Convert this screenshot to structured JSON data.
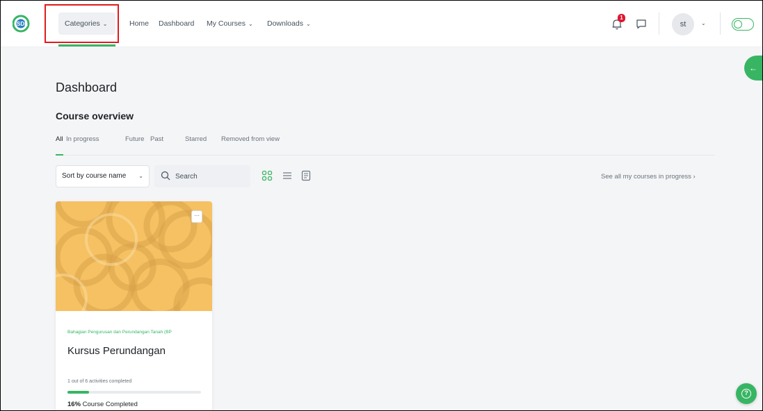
{
  "logo": {
    "text": "SDL"
  },
  "nav": {
    "items": [
      {
        "label": "Categories",
        "has_dropdown": true
      },
      {
        "label": "Home",
        "has_dropdown": false
      },
      {
        "label": "Dashboard",
        "has_dropdown": false
      },
      {
        "label": "My Courses",
        "has_dropdown": true
      },
      {
        "label": "Downloads",
        "has_dropdown": true
      }
    ],
    "notification_count": "1",
    "user_initials": "st"
  },
  "colors": {
    "accent": "#37b563",
    "highlight_box": "#e01a1a",
    "badge": "#e0142e"
  },
  "page": {
    "title": "Dashboard",
    "section_title": "Course overview",
    "tabs": [
      "All",
      "In progress",
      "Future",
      "Past",
      "Starred",
      "Removed from view"
    ],
    "active_tab": "All",
    "sort_label": "Sort by course name",
    "search_placeholder": "Search",
    "view_modes": [
      "grid-view-icon",
      "list-view-icon",
      "summary-view-icon"
    ],
    "see_all": "See all my courses in progress"
  },
  "course": {
    "category": "Bahagian Pengurusan dan Perundangan Tanah (BP",
    "name": "Kursus Perundangan",
    "activities_text": "1 out of 6 activities completed",
    "progress_fraction": 0.16,
    "percent_value": "16%",
    "percent_suffix": " Course Completed"
  },
  "help": {
    "icon": "question-icon"
  }
}
